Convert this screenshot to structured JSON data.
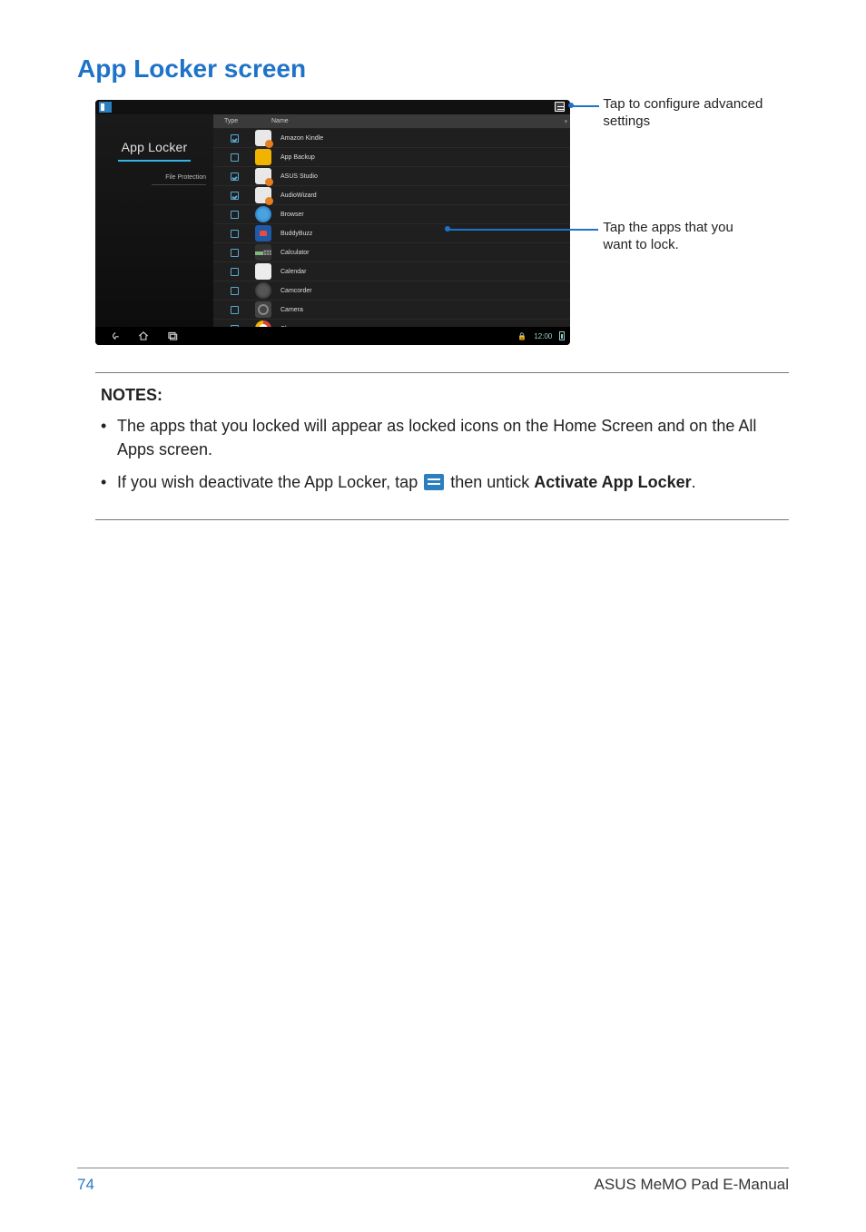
{
  "title": "App Locker screen",
  "callouts": {
    "settings": "Tap to configure advanced settings",
    "tap_apps_line1": "Tap the apps that you",
    "tap_apps_line2": "want to lock."
  },
  "device": {
    "sidebar_title": "App Locker",
    "sidebar_sub": "File Protection",
    "list_header_type": "Type",
    "list_header_name": "Name",
    "navbar_time": "12:00",
    "apps": [
      {
        "checked": true,
        "iconClass": "ic-amazon",
        "label": "Amazon Kindle"
      },
      {
        "checked": false,
        "iconClass": "ic-appbackup",
        "label": "App Backup"
      },
      {
        "checked": true,
        "iconClass": "ic-asusstudio",
        "label": "ASUS Studio"
      },
      {
        "checked": true,
        "iconClass": "ic-audiowizard",
        "label": "AudioWizard"
      },
      {
        "checked": false,
        "iconClass": "ic-browser",
        "label": "Browser"
      },
      {
        "checked": false,
        "iconClass": "ic-buddybuzz",
        "label": "BuddyBuzz"
      },
      {
        "checked": false,
        "iconClass": "ic-calculator",
        "label": "Calculator"
      },
      {
        "checked": false,
        "iconClass": "ic-calendar",
        "label": "Calendar"
      },
      {
        "checked": false,
        "iconClass": "ic-camcorder",
        "label": "Camcorder"
      },
      {
        "checked": false,
        "iconClass": "ic-camera",
        "label": "Camera"
      },
      {
        "checked": false,
        "iconClass": "ic-chrome",
        "label": "Chrome"
      }
    ]
  },
  "notes": {
    "heading": "NOTES:",
    "item1": "The apps that you locked will appear as locked icons on the Home Screen and on the All Apps screen.",
    "item2_pre": "If you wish deactivate the App Locker, tap ",
    "item2_mid": " then untick ",
    "item2_bold": "Activate App Locker",
    "item2_post": "."
  },
  "footer": {
    "page": "74",
    "product": "ASUS MeMO Pad E-Manual"
  }
}
